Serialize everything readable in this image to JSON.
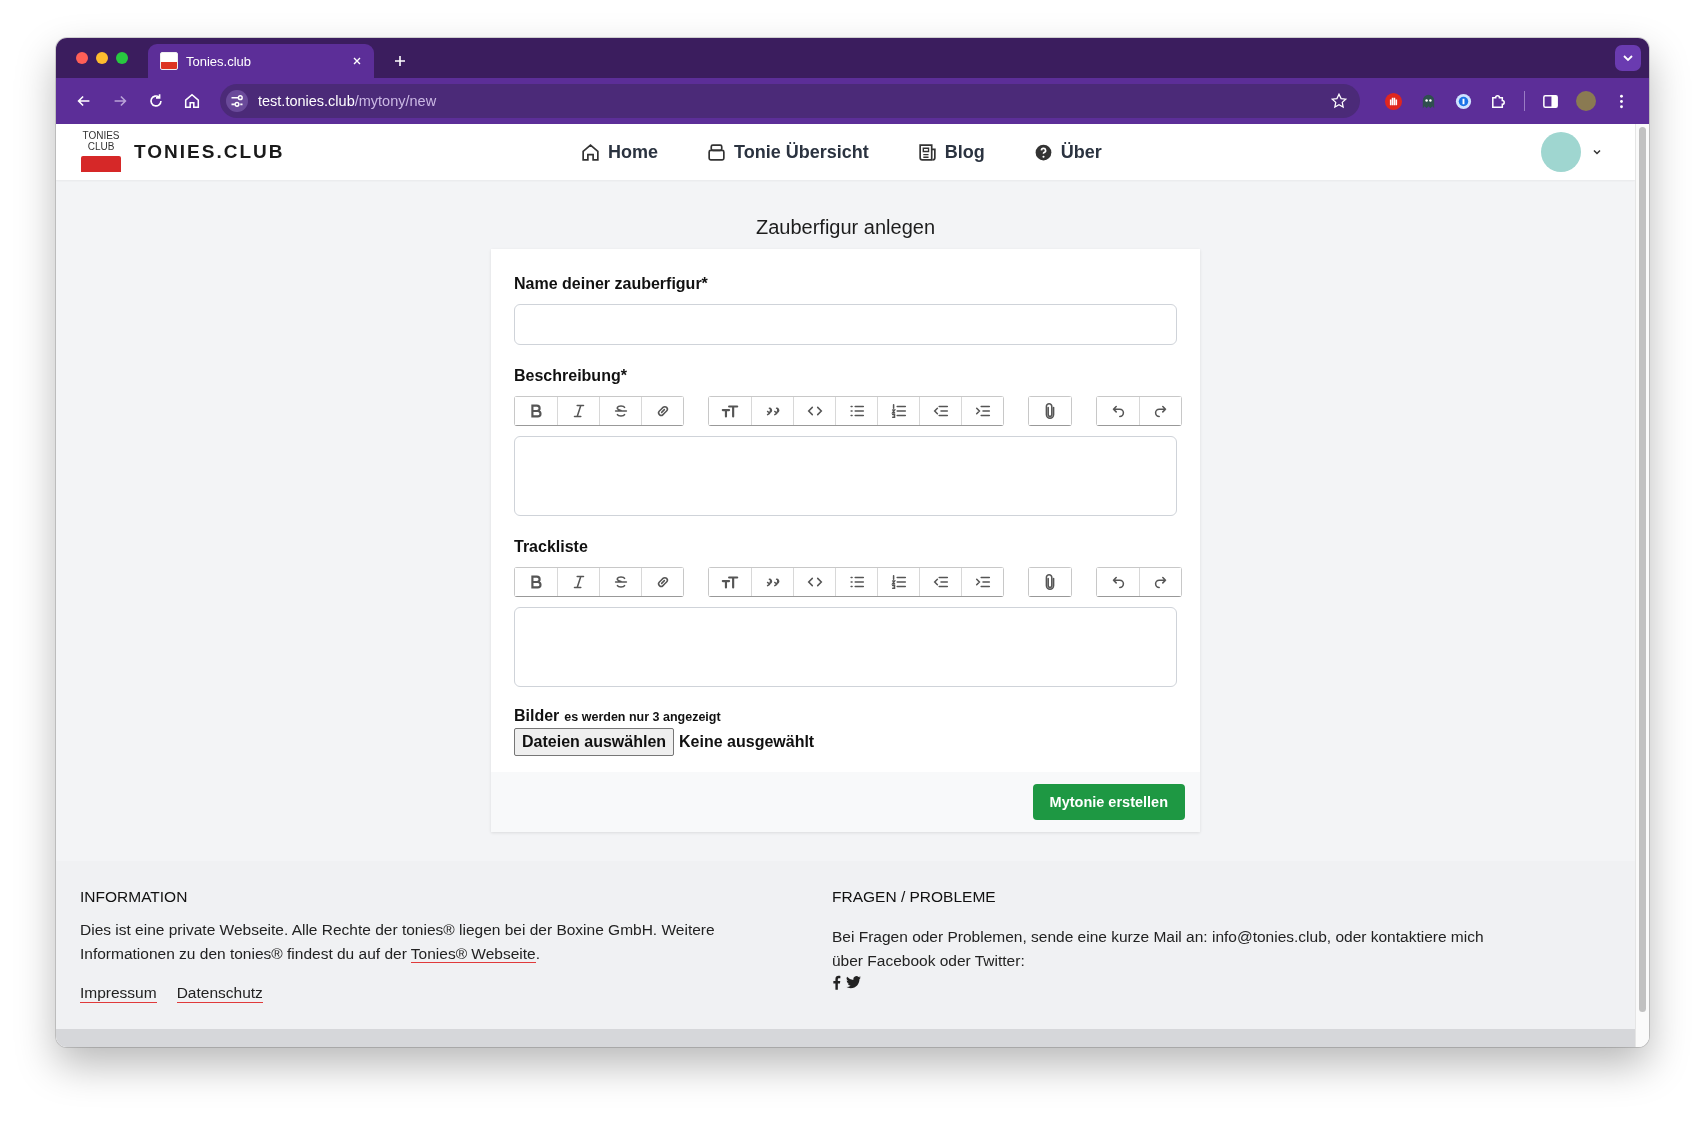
{
  "browser": {
    "tab": {
      "title": "Tonies.club",
      "selected": true
    },
    "url": {
      "host": "test.tonies.club",
      "path": "/mytony/new"
    }
  },
  "header": {
    "logo_text": [
      "TONIES",
      "CLUB"
    ],
    "brand": "TONIES.CLUB",
    "nav": [
      {
        "label": "Home"
      },
      {
        "label": "Tonie Übersicht"
      },
      {
        "label": "Blog"
      },
      {
        "label": "Über"
      }
    ]
  },
  "form": {
    "title": "Zauberfigur anlegen",
    "fields": [
      {
        "kind": "text",
        "label": "Name deiner zauberfigur*"
      },
      {
        "kind": "editor",
        "label": "Beschreibung*"
      },
      {
        "kind": "editor",
        "label": "Trackliste"
      }
    ],
    "images": {
      "label": "Bilder",
      "hint": "es werden nur 3 angezeigt",
      "button": "Dateien auswählen",
      "status": "Keine ausgewählt"
    },
    "submit": "Mytonie erstellen"
  },
  "footer": {
    "info": {
      "heading": "INFORMATION",
      "text_before": "Dies ist eine private Webseite. Alle Rechte der tonies® liegen bei der Boxine GmbH. Weitere Informationen zu den tonies® findest du auf der ",
      "link": "Tonies® Webseite",
      "text_after": ".",
      "links": [
        "Impressum",
        "Datenschutz"
      ]
    },
    "contact": {
      "heading": "FRAGEN / PROBLEME",
      "text": "Bei Fragen oder Problemen, sende eine kurze Mail an: info@tonies.club, oder kontaktiere mich über Facebook oder Twitter:"
    }
  }
}
